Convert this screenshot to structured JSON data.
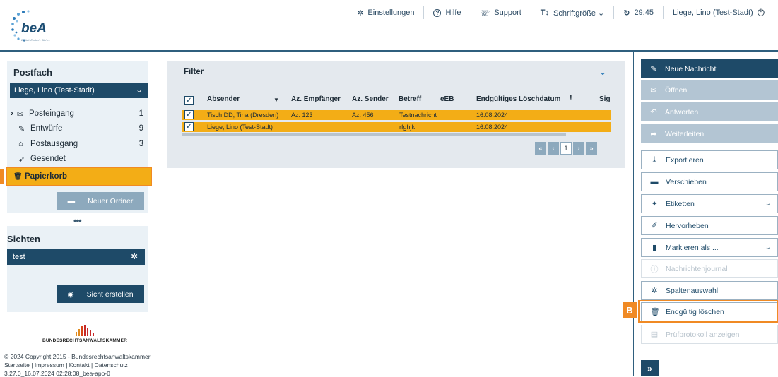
{
  "header": {
    "logo_text": "beA",
    "logo_tagline": "Digital. Einfach. Sicher.",
    "nav": [
      {
        "icon": "gear-icon",
        "glyph": "✲",
        "label": "Einstellungen"
      },
      {
        "icon": "help-icon",
        "glyph": "?",
        "label": "Hilfe"
      },
      {
        "icon": "support-icon",
        "glyph": "☏",
        "label": "Support"
      },
      {
        "icon": "font-size-icon",
        "glyph": "T↕",
        "label": "Schriftgröße ⌄"
      },
      {
        "icon": "refresh-icon",
        "glyph": "↻",
        "label": "29:45"
      },
      {
        "icon": "user-icon",
        "glyph": "",
        "label": "Liege, Lino (Test-Stadt)"
      }
    ],
    "power_glyph": "⏻"
  },
  "sidebar": {
    "title": "Postfach",
    "mailbox": "Liege, Lino (Test-Stadt)",
    "items": [
      {
        "prefix": "›",
        "icon": "✉",
        "label": "Posteingang",
        "count": "1"
      },
      {
        "prefix": "",
        "icon": "✎",
        "label": "Entwürfe",
        "count": "9"
      },
      {
        "prefix": "",
        "icon": "⌂",
        "label": "Postausgang",
        "count": "3"
      },
      {
        "prefix": "",
        "icon": "➶",
        "label": "Gesendet",
        "count": ""
      }
    ],
    "trash_icon": "🗑",
    "trash_label": "Papierkorb",
    "marker_a": "A",
    "new_folder": "Neuer Ordner",
    "dots": "•••",
    "views_title": "Sichten",
    "view_name": "test",
    "create_view": "Sicht erstellen"
  },
  "footer": {
    "org": "BUNDESRECHTSANWALTSKAMMER",
    "copyright": "© 2024 Copyright 2015 - Bundesrechtsanwaltskammer",
    "links": "Startseite | Impressum | Kontakt | Datenschutz",
    "version": "3.27.0_16.07.2024 02:28:08_bea-app-0"
  },
  "filter": {
    "title": "Filter",
    "columns": {
      "absender": "Absender",
      "sort": "▼",
      "az_empfaenger": "Az. Empfänger",
      "az_sender": "Az. Sender",
      "betreff": "Betreff",
      "eeb": "eEB",
      "loeschdatum": "Endgültiges Löschdatum",
      "flag": "!",
      "sig": "Sig"
    },
    "rows": [
      {
        "absender": "Tisch DD, Tina (Dresden)",
        "az_empfaenger": "Az. 123",
        "az_sender": "Az. 456",
        "betreff": "Testnachricht",
        "loeschdatum": "16.08.2024"
      },
      {
        "absender": "Liege, Lino (Test-Stadt)",
        "az_empfaenger": "",
        "az_sender": "",
        "betreff": "rfghjk",
        "loeschdatum": "16.08.2024"
      }
    ],
    "pager": {
      "first": "«",
      "prev": "‹",
      "page": "1",
      "next": "›",
      "last": "»"
    }
  },
  "actions": [
    {
      "name": "new-message-button",
      "icon": "✎",
      "label": "Neue Nachricht",
      "style": "dark"
    },
    {
      "name": "open-button",
      "icon": "✉",
      "label": "Öffnen",
      "style": "grey"
    },
    {
      "name": "reply-button",
      "icon": "↶",
      "label": "Antworten",
      "style": "grey"
    },
    {
      "name": "forward-button",
      "icon": "➦",
      "label": "Weiterleiten",
      "style": "grey"
    },
    {
      "name": "export-button",
      "icon": "⤓",
      "label": "Exportieren",
      "style": "light"
    },
    {
      "name": "move-button",
      "icon": "▬",
      "label": "Verschieben",
      "style": "light"
    },
    {
      "name": "labels-button",
      "icon": "✦",
      "label": "Etiketten",
      "style": "light",
      "chevron": "⌄"
    },
    {
      "name": "highlight-button",
      "icon": "✐",
      "label": "Hervorheben",
      "style": "light"
    },
    {
      "name": "mark-as-button",
      "icon": "▮",
      "label": "Markieren als ...",
      "style": "light",
      "chevron": "⌄"
    },
    {
      "name": "message-journal-button",
      "icon": "ⓘ",
      "label": "Nachrichtenjournal",
      "style": "dis"
    },
    {
      "name": "column-select-button",
      "icon": "✲",
      "label": "Spaltenauswahl",
      "style": "light"
    },
    {
      "name": "delete-permanently-button",
      "icon": "🗑",
      "label": "Endgültig löschen",
      "style": "light"
    },
    {
      "name": "audit-log-button",
      "icon": "▤",
      "label": "Prüfprotokoll anzeigen",
      "style": "dis"
    }
  ],
  "marker_b": "B",
  "collapse_glyph": "»"
}
